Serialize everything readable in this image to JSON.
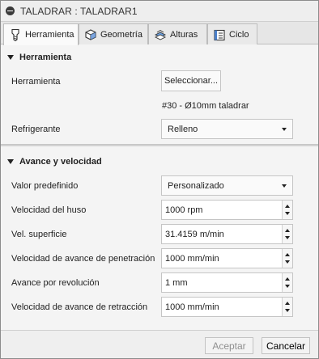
{
  "window": {
    "title": "TALADRAR : TALADRAR1"
  },
  "tabs": [
    {
      "label": "Herramienta",
      "icon": "drill-tool-icon",
      "active": true
    },
    {
      "label": "Geometría",
      "icon": "geometry-cube-icon",
      "active": false
    },
    {
      "label": "Alturas",
      "icon": "heights-icon",
      "active": false
    },
    {
      "label": "Ciclo",
      "icon": "cycle-icon",
      "active": false
    }
  ],
  "tool_section": {
    "header": "Herramienta",
    "tool_label": "Herramienta",
    "select_button": "Seleccionar...",
    "tool_name": "#30 - Ø10mm taladrar",
    "coolant_label": "Refrigerante",
    "coolant_value": "Relleno"
  },
  "feed_section": {
    "header": "Avance y velocidad",
    "preset_label": "Valor predefinido",
    "preset_value": "Personalizado",
    "fields": [
      {
        "label": "Velocidad del huso",
        "value": "1000 rpm"
      },
      {
        "label": "Vel. superficie",
        "value": "31.4159 m/min"
      },
      {
        "label": "Velocidad de avance de penetración",
        "value": "1000 mm/min"
      },
      {
        "label": "Avance por revolución",
        "value": "1 mm"
      },
      {
        "label": "Velocidad de avance de retracción",
        "value": "1000 mm/min"
      }
    ]
  },
  "footer": {
    "ok_label": "Aceptar",
    "cancel_label": "Cancelar"
  },
  "colors": {
    "background": "#f4f4f4",
    "title_bar": "#eeeeee",
    "border": "#c5c5c5",
    "disabled_text": "#8f8f8f"
  }
}
